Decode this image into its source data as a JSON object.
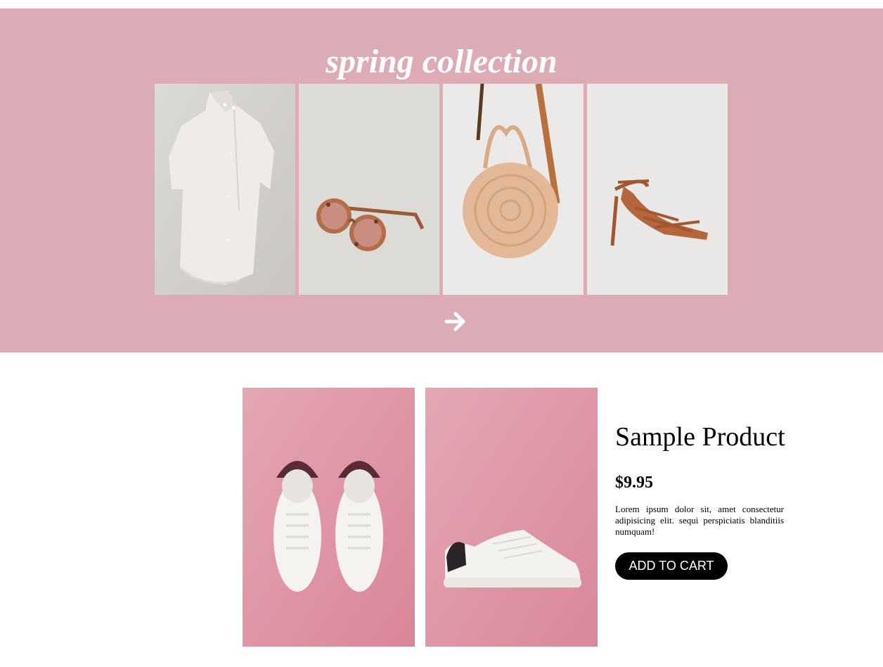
{
  "hero": {
    "title": "spring collection",
    "items": [
      {
        "name": "white shirt dress"
      },
      {
        "name": "tortoiseshell sunglasses"
      },
      {
        "name": "round straw bag"
      },
      {
        "name": "strappy heeled sandal"
      }
    ],
    "next_icon": "arrow-right-icon"
  },
  "product": {
    "title": "Sample Product",
    "price": "$9.95",
    "description": "Lorem ipsum dolor sit, amet consectetur adipisicing elit. sequi perspiciatis blanditiis numquam!",
    "cart_label": "ADD TO CART",
    "images": [
      {
        "name": "white sneakers top view"
      },
      {
        "name": "white sneaker side view"
      }
    ]
  },
  "colors": {
    "hero_bg": "#dcabb5",
    "button_bg": "#000000",
    "thumb_bg": "#e096a8"
  }
}
